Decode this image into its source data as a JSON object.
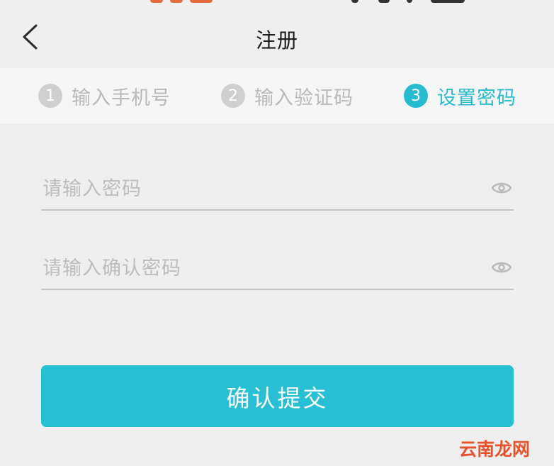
{
  "header": {
    "title": "注册",
    "back_icon": "chevron-left-icon"
  },
  "steps": [
    {
      "number": "1",
      "label": "输入手机号",
      "active": false
    },
    {
      "number": "2",
      "label": "输入验证码",
      "active": false
    },
    {
      "number": "3",
      "label": "设置密码",
      "active": true
    }
  ],
  "form": {
    "password": {
      "placeholder": "请输入密码",
      "value": "",
      "icon": "eye-icon"
    },
    "confirm_password": {
      "placeholder": "请输入确认密码",
      "value": "",
      "icon": "eye-icon"
    },
    "submit_label": "确认提交"
  },
  "watermark": "云南龙网",
  "colors": {
    "accent": "#27bfd3",
    "inactive": "#cfcfcf",
    "background": "#efefef",
    "watermark": "#e8522a"
  }
}
